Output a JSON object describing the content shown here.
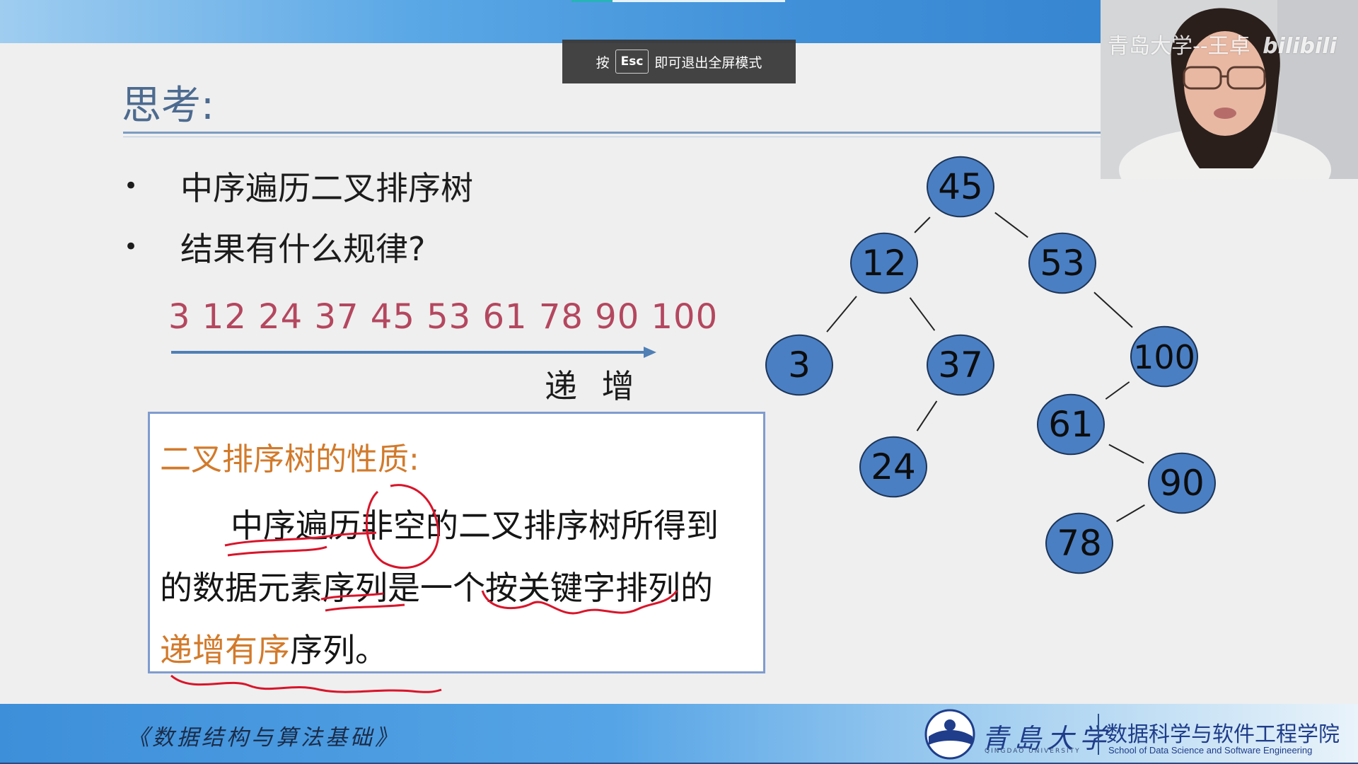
{
  "esc_notice": {
    "prefix": "按",
    "key": "Esc",
    "suffix": "即可退出全屏模式"
  },
  "slide": {
    "title": "思考:",
    "bullets": [
      "中序遍历二叉排序树",
      "结果有什么规律?"
    ],
    "bullet_symbol": "•",
    "sequence": "3 12 24 37 45 53 61 78 90 100",
    "arrow_label": "递 增",
    "property": {
      "title": "二叉排序树的性质:",
      "line1": "中序遍历非空的二叉排序树所得到",
      "line2": "的数据元素序列是一个按关键字排列的",
      "line3_highlight": "递增有序",
      "line3_rest": "序列。"
    },
    "tree": {
      "node_color": "#4a7fc4",
      "nodes": [
        {
          "id": "n45",
          "label": "45"
        },
        {
          "id": "n12",
          "label": "12"
        },
        {
          "id": "n53",
          "label": "53"
        },
        {
          "id": "n3",
          "label": "3"
        },
        {
          "id": "n37",
          "label": "37"
        },
        {
          "id": "n100",
          "label": "100"
        },
        {
          "id": "n24",
          "label": "24"
        },
        {
          "id": "n61",
          "label": "61"
        },
        {
          "id": "n90",
          "label": "90"
        },
        {
          "id": "n78",
          "label": "78"
        }
      ]
    }
  },
  "webcam": {
    "watermark": "青岛大学--王卓",
    "platform_logo": "bilibili"
  },
  "footer": {
    "course_name": "《数据结构与算法基础》",
    "university_name": "青島大学",
    "university_en": "QINGDAO UNIVERSITY",
    "school_cn": "数据科学与软件工程学院",
    "school_en": "School of Data Science and Software Engineering"
  },
  "colors": {
    "title_blue": "#4d6b90",
    "sequence_red": "#b4475f",
    "highlight_orange": "#d27a2b",
    "annotation_red": "#d8152a"
  }
}
